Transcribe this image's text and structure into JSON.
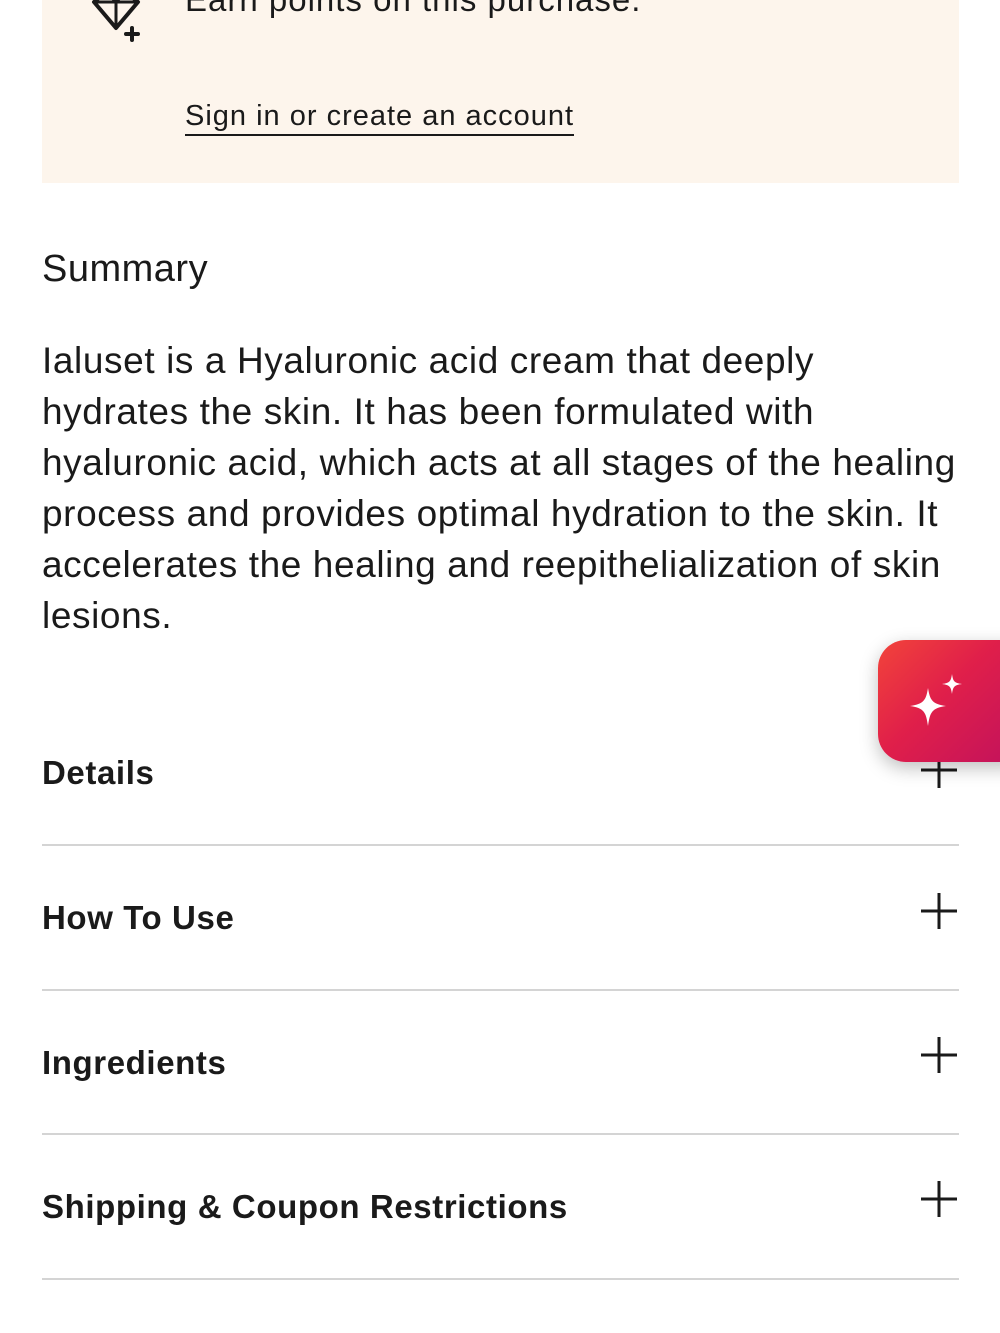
{
  "rewards": {
    "headline": "Earn points on this purchase.",
    "signin_link": "Sign in or create an account"
  },
  "summary": {
    "heading": "Summary",
    "body": "Ialuset is a Hyaluronic acid cream that deeply hydrates the skin. It has been formulated with hyaluronic acid, which acts at all stages of the healing process and provides optimal hydration to the skin. It accelerates the healing and reepithelialization of skin lesions."
  },
  "accordion": {
    "items": [
      {
        "label": "Details",
        "icon": "plus-icon"
      },
      {
        "label": "How To Use",
        "icon": "plus-icon"
      },
      {
        "label": "Ingredients",
        "icon": "plus-icon"
      },
      {
        "label": "Shipping & Coupon Restrictions",
        "icon": "plus-icon"
      }
    ]
  },
  "ai_assistant": {
    "icon": "sparkle-icon",
    "gradient_colors": [
      "#f2443a",
      "#c2125c"
    ]
  },
  "colors": {
    "banner_background": "#fdf5ec",
    "text": "#1a1a1a",
    "divider": "#d4d4d4"
  }
}
